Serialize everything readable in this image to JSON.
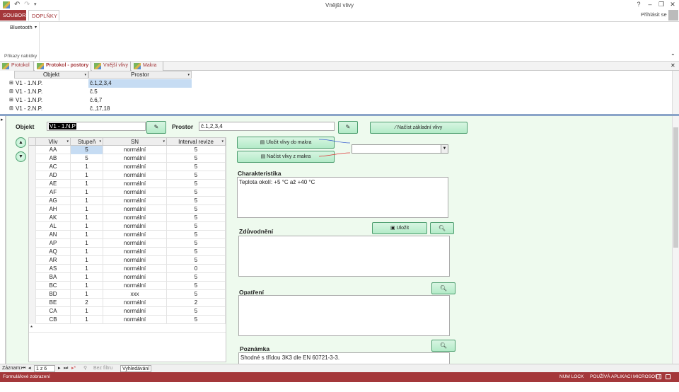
{
  "window": {
    "title": "Vnější vlivy",
    "help": "?",
    "signin": "Přihlásit se"
  },
  "ribbon": {
    "tabs": [
      {
        "label": "SOUBOR"
      },
      {
        "label": "DOPLŇKY"
      }
    ],
    "bluetooth": "Bluetooth",
    "group_label": "Příkazy nabídky"
  },
  "object_tabs": [
    {
      "label": "Protokol"
    },
    {
      "label": "Protokol - postory"
    },
    {
      "label": "Vnější vlivy"
    },
    {
      "label": "Makra"
    }
  ],
  "top_grid": {
    "columns": [
      "Objekt",
      "Prostor"
    ],
    "rows": [
      {
        "objekt": "V1 - 1.N.P.",
        "prostor": "č.1,2,3,4"
      },
      {
        "objekt": "V1 - 1.N.P.",
        "prostor": "č.5"
      },
      {
        "objekt": "V1 - 1.N.P.",
        "prostor": "č.6,7"
      },
      {
        "objekt": "V1 - 2.N.P.",
        "prostor": "č.,17,18"
      }
    ]
  },
  "form": {
    "objekt_label": "Objekt",
    "objekt_value": "V1 - 1.N.P",
    "prostor_label": "Prostor",
    "prostor_value": "č.1,2,3,4",
    "load_basic": "Načíst základní vlivy",
    "save_to_macro": "Uložit vlivy do makra",
    "load_from_macro": "Načíst vlivy z makra",
    "charakteristika_label": "Charakteristika",
    "charakteristika_value": "Teplota okolí: +5 °C až +40 °C",
    "zduvodneni_label": "Zdůvodnění",
    "save": "Uložit",
    "opatreni_label": "Opatření",
    "poznamka_label": "Poznámka",
    "poznamka_value": "Shodné s třídou 3K3 dle EN 60721-3-3."
  },
  "vlivy_grid": {
    "columns": [
      "Vliv",
      "Stupeň",
      "SN",
      "Interval revize"
    ],
    "rows": [
      [
        "AA",
        "5",
        "normální",
        "5"
      ],
      [
        "AB",
        "5",
        "normální",
        "5"
      ],
      [
        "AC",
        "1",
        "normální",
        "5"
      ],
      [
        "AD",
        "1",
        "normální",
        "5"
      ],
      [
        "AE",
        "1",
        "normální",
        "5"
      ],
      [
        "AF",
        "1",
        "normální",
        "5"
      ],
      [
        "AG",
        "1",
        "normální",
        "5"
      ],
      [
        "AH",
        "1",
        "normální",
        "5"
      ],
      [
        "AK",
        "1",
        "normální",
        "5"
      ],
      [
        "AL",
        "1",
        "normální",
        "5"
      ],
      [
        "AN",
        "1",
        "normální",
        "5"
      ],
      [
        "AP",
        "1",
        "normální",
        "5"
      ],
      [
        "AQ",
        "1",
        "normální",
        "5"
      ],
      [
        "AR",
        "1",
        "normální",
        "5"
      ],
      [
        "AS",
        "1",
        "normální",
        "0"
      ],
      [
        "BA",
        "1",
        "normální",
        "5"
      ],
      [
        "BC",
        "1",
        "normální",
        "5"
      ],
      [
        "BD",
        "1",
        "xxx",
        "5"
      ],
      [
        "BE",
        "2",
        "normální",
        "2"
      ],
      [
        "CA",
        "1",
        "normální",
        "5"
      ],
      [
        "CB",
        "1",
        "normální",
        "5"
      ]
    ],
    "new_row_marker": "*"
  },
  "record_nav": {
    "label": "Záznam:",
    "position": "1 z 6",
    "filter": "Bez filtru",
    "search": "Vyhledávání"
  },
  "status": {
    "left": "Formulářové zobrazení",
    "numlock": "NUM LOCK",
    "right": "POUŽÍVÁ APLIKACI MICROSOFT ACCESS."
  }
}
